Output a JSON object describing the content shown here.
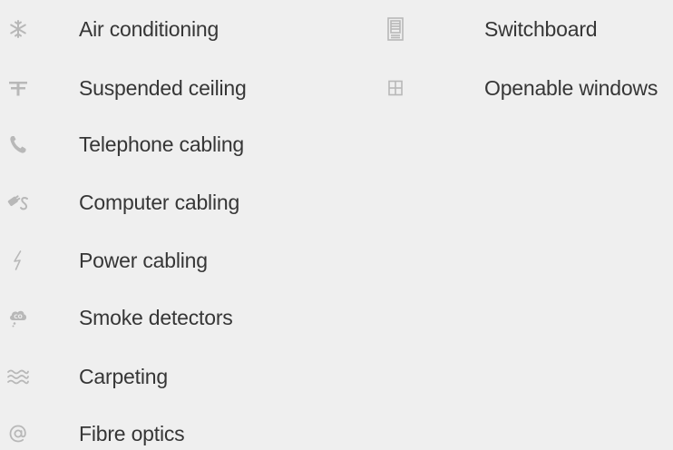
{
  "features": {
    "left": [
      {
        "label": "Air conditioning",
        "icon": "snowflake-icon"
      },
      {
        "label": "Suspended ceiling",
        "icon": "suspended-ceiling-icon"
      },
      {
        "label": "Telephone cabling",
        "icon": "telephone-icon"
      },
      {
        "label": "Computer cabling",
        "icon": "computer-cable-icon"
      },
      {
        "label": "Power cabling",
        "icon": "lightning-icon"
      },
      {
        "label": "Smoke detectors",
        "icon": "smoke-detector-icon"
      },
      {
        "label": "Carpeting",
        "icon": "carpet-icon"
      },
      {
        "label": "Fibre optics",
        "icon": "at-sign-icon"
      }
    ],
    "right": [
      {
        "label": "Switchboard",
        "icon": "switchboard-icon"
      },
      {
        "label": "Openable windows",
        "icon": "window-icon"
      }
    ]
  },
  "colors": {
    "background": "#efefef",
    "text": "#363636",
    "icon": "#b8b8b8"
  }
}
